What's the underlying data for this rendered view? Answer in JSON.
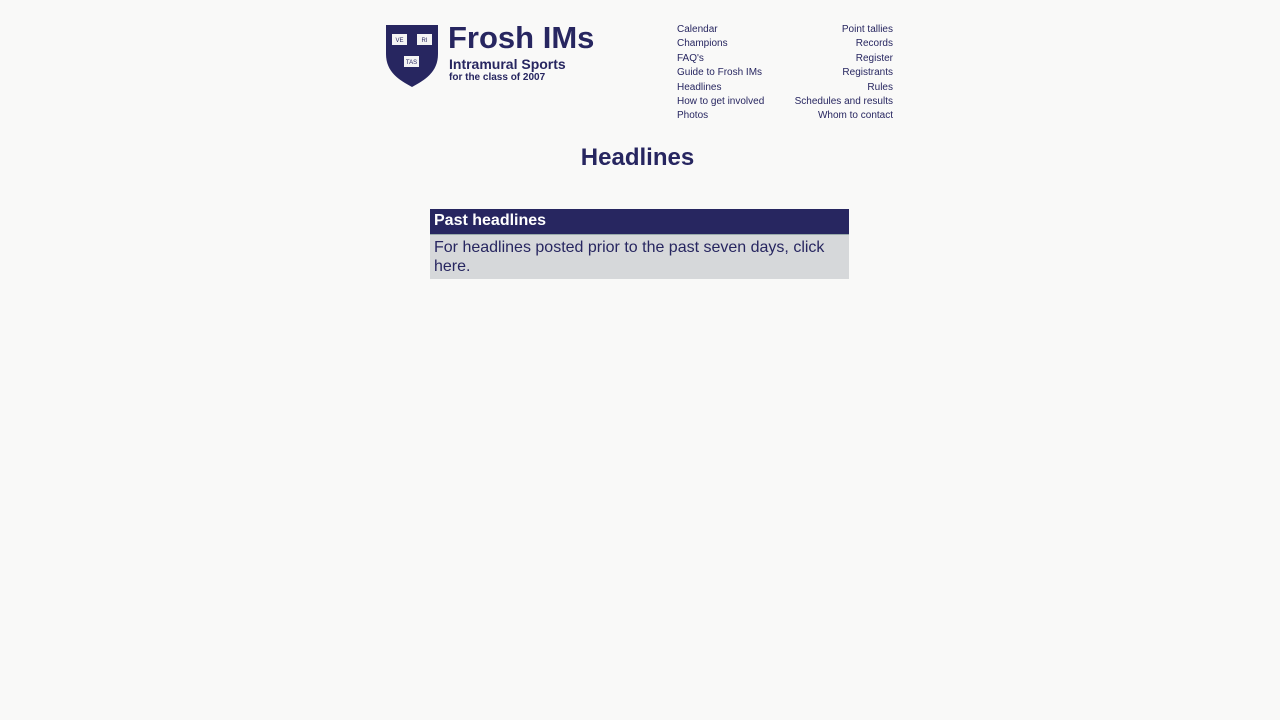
{
  "header": {
    "logo_shield": [
      "VE",
      "RI",
      "TAS"
    ],
    "title": "Frosh IMs",
    "subtitle": "Intramural Sports",
    "tagline": "for the class of 2007"
  },
  "nav": {
    "left": [
      "Calendar",
      "Champions",
      "FAQ's",
      "Guide to Frosh IMs",
      "Headlines",
      "How to get involved",
      "Photos"
    ],
    "right": [
      "Point tallies",
      "Records",
      "Register",
      "Registrants",
      "Rules",
      "Schedules and results",
      "Whom to contact"
    ]
  },
  "page_title": "Headlines",
  "box": {
    "heading": "Past headlines",
    "text": "For headlines posted prior to the past seven days, click",
    "link": "here."
  },
  "colors": {
    "brand": "#272660",
    "box_body": "#d6d8da",
    "background": "#f9f9f8"
  }
}
